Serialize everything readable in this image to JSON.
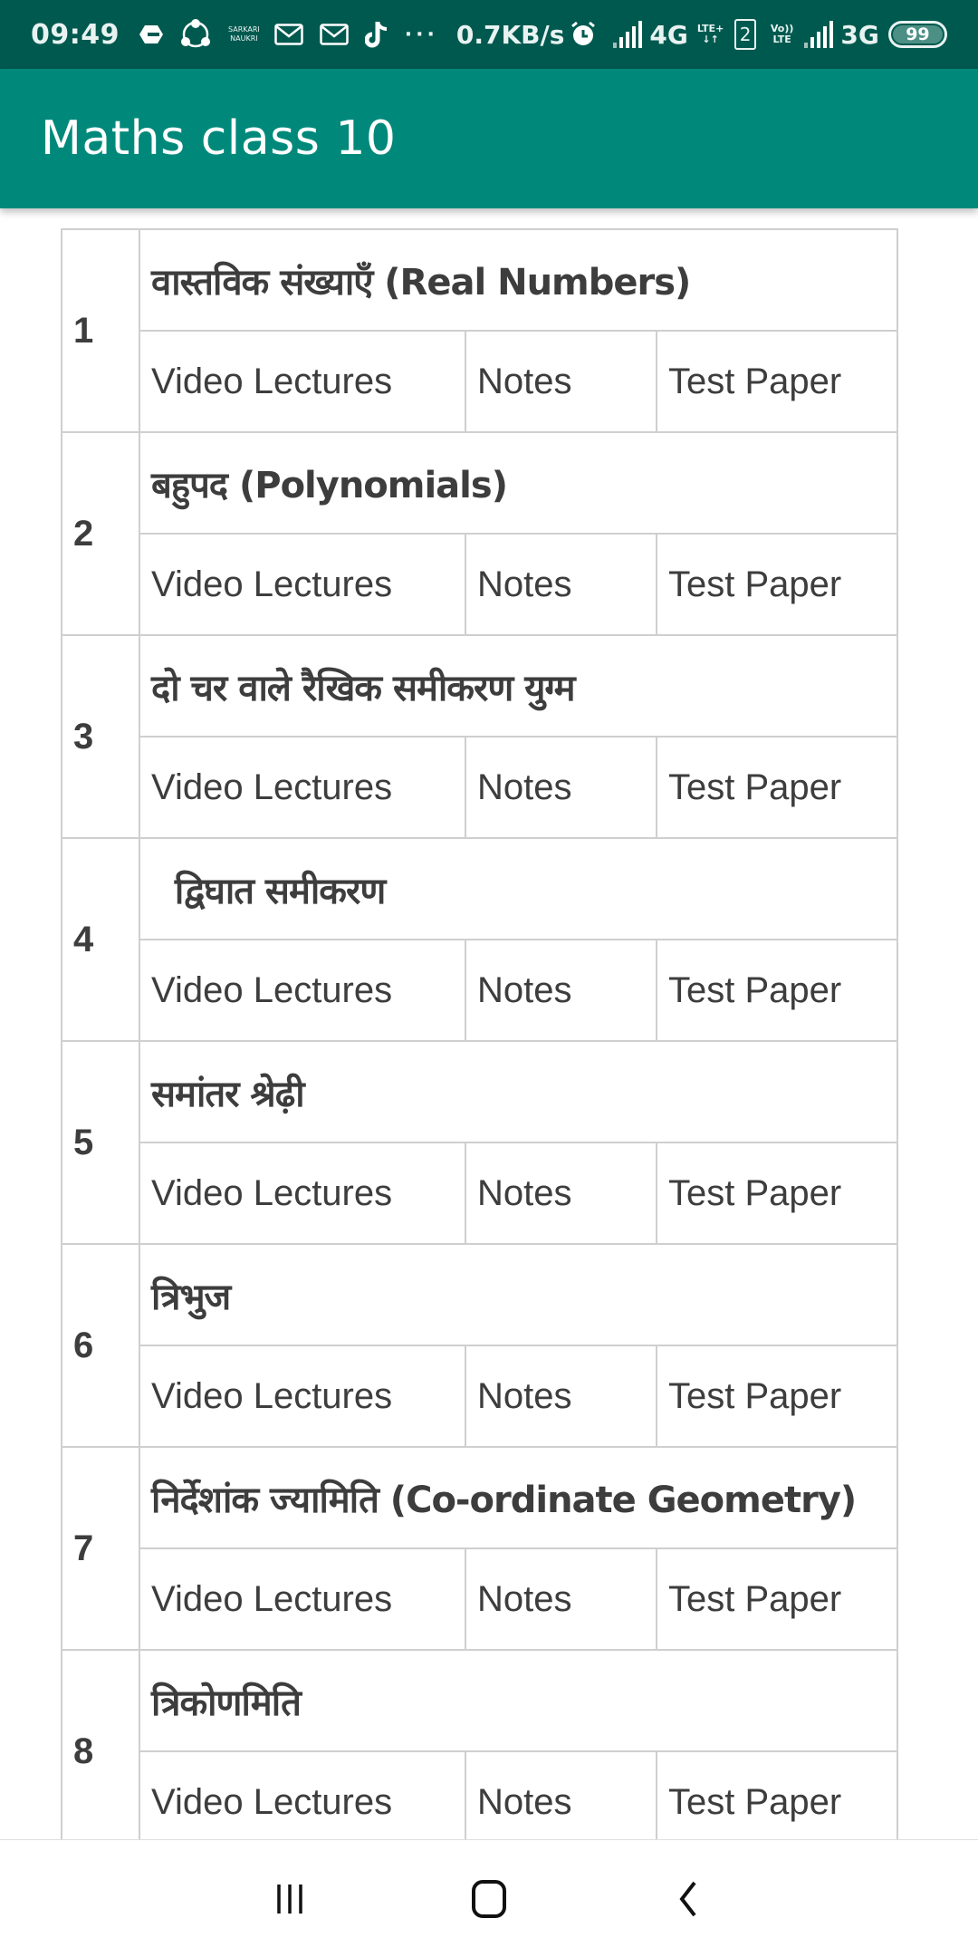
{
  "status_bar": {
    "time": "09:49",
    "notification_icons": [
      "drive-icon",
      "shareit-icon",
      "sarkari-naukri-icon",
      "mail-icon",
      "mail-icon",
      "tiktok-icon"
    ],
    "sarkari_line1": "SARKARI",
    "sarkari_line2": "NAUKRI",
    "more": "···",
    "net_speed": "0.7KB/s",
    "network1": "4G",
    "lte_plus": "LTE+",
    "sim_label": "2",
    "volte_line1": "Vo))",
    "volte_line2": "LTE",
    "network2": "3G",
    "battery": "99"
  },
  "app_bar": {
    "title": "Maths class 10"
  },
  "chapters": [
    {
      "number": "1",
      "title": "वास्तविक संख्याएँ (Real Numbers)",
      "video": "Video Lectures",
      "notes": "Notes",
      "test": "Test Paper"
    },
    {
      "number": "2",
      "title": "बहुपद (Polynomials)",
      "video": "Video Lectures",
      "notes": "Notes",
      "test": "Test Paper"
    },
    {
      "number": "3",
      "title": "दो चर वाले रैखिक समीकरण युग्म",
      "video": "Video Lectures",
      "notes": "Notes",
      "test": "Test Paper"
    },
    {
      "number": "4",
      "title": "  द्विघात समीकरण",
      "video": "Video Lectures",
      "notes": "Notes",
      "test": "Test Paper"
    },
    {
      "number": "5",
      "title": "समांतर श्रेढ़ी",
      "video": "Video Lectures",
      "notes": "Notes",
      "test": "Test Paper"
    },
    {
      "number": "6",
      "title": "त्रिभुज",
      "video": "Video Lectures",
      "notes": "Notes",
      "test": "Test Paper"
    },
    {
      "number": "7",
      "title": "निर्देशांक ज्यामिति (Co-ordinate Geometry)",
      "video": "Video Lectures",
      "notes": "Notes",
      "test": "Test Paper"
    },
    {
      "number": "8",
      "title": "त्रिकोणमिति",
      "video": "Video Lectures",
      "notes": "Notes",
      "test": "Test Paper"
    }
  ],
  "colors": {
    "status_bar": "#00594f",
    "app_bar": "#00897b",
    "link_video": "#8b0000",
    "text": "#3d3d3d",
    "border": "#cfcfcf"
  },
  "nav_bar": {
    "buttons": [
      "recents",
      "home",
      "back"
    ]
  }
}
